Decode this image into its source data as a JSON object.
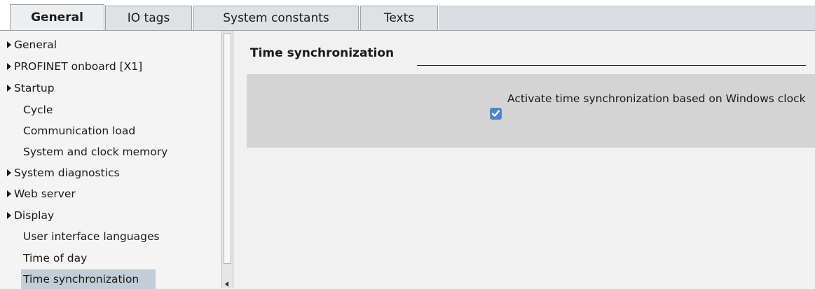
{
  "tabs": [
    {
      "label": "General",
      "active": true
    },
    {
      "label": "IO tags",
      "active": false
    },
    {
      "label": "System constants",
      "active": false
    },
    {
      "label": "Texts",
      "active": false
    }
  ],
  "nav": {
    "items": [
      {
        "label": "General",
        "expandable": true
      },
      {
        "label": "PROFINET onboard [X1]",
        "expandable": true
      },
      {
        "label": "Startup",
        "expandable": true
      },
      {
        "label": "Cycle",
        "expandable": false
      },
      {
        "label": "Communication load",
        "expandable": false
      },
      {
        "label": "System and clock memory",
        "expandable": false
      },
      {
        "label": "System diagnostics",
        "expandable": true
      },
      {
        "label": "Web server",
        "expandable": true
      },
      {
        "label": "Display",
        "expandable": true
      },
      {
        "label": "User interface languages",
        "expandable": false
      },
      {
        "label": "Time of day",
        "expandable": false
      },
      {
        "label": "Time synchronization",
        "expandable": false,
        "selected": true
      }
    ]
  },
  "main": {
    "section_title": "Time synchronization",
    "checkbox": {
      "label": "Activate time synchronization based on Windows clock",
      "checked": true
    }
  },
  "colors": {
    "selected_bg": "#c3cdd7",
    "panel_bg": "#d4d4d4",
    "checkbox_accent": "#4d86c9"
  }
}
